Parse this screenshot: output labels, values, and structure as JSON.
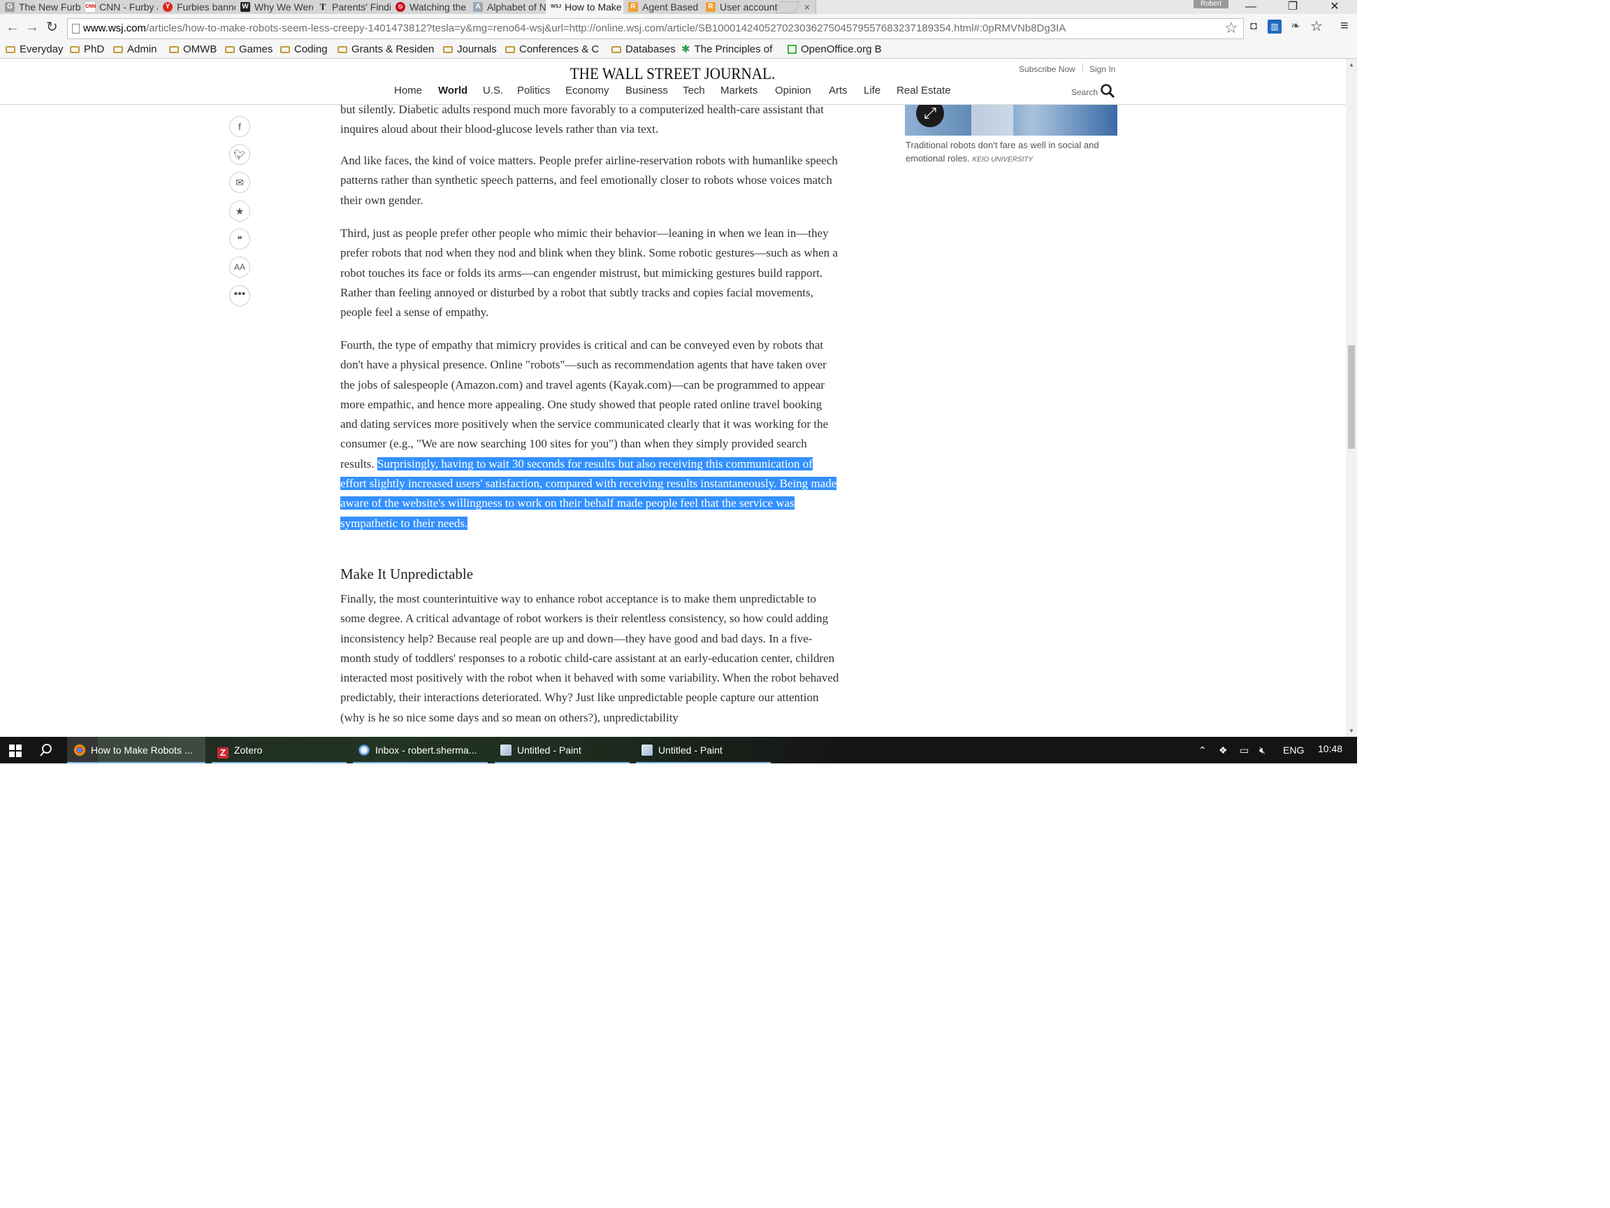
{
  "browser": {
    "tabs": [
      {
        "title": "The New Furby is",
        "favicon": "G",
        "favicon_color": "#777777",
        "active": false
      },
      {
        "title": "CNN - Furby a th",
        "favicon": "CNN",
        "favicon_color": "#cc0000",
        "active": false
      },
      {
        "title": "Furbies banned",
        "favicon": "Y",
        "favicon_color": "#e0261b",
        "active": false
      },
      {
        "title": "Why We Were A",
        "favicon": "W",
        "favicon_color": "#222222",
        "active": false
      },
      {
        "title": "Parents' Finding",
        "favicon": "T",
        "favicon_color": "#222222",
        "active": false
      },
      {
        "title": "Watching the Fu",
        "favicon": "⦸",
        "favicon_color": "#d0021b",
        "active": false
      },
      {
        "title": "Alphabet of No",
        "favicon": "A",
        "favicon_color": "#9aa7b3",
        "active": false
      },
      {
        "title": "How to Make Ro",
        "favicon": "WSJ",
        "favicon_color": "#333333",
        "active": true
      },
      {
        "title": "Agent Based M",
        "favicon": "R",
        "favicon_color": "#f0a030",
        "active": false
      },
      {
        "title": "User account | R",
        "favicon": "R",
        "favicon_color": "#f0a030",
        "active": false
      }
    ],
    "profile_name": "Robert",
    "window_controls": {
      "minimize": "—",
      "restore": "❐",
      "close": "✕"
    },
    "url_host": "www.wsj.com",
    "url_rest": "/articles/how-to-make-robots-seem-less-creepy-1401473812?tesla=y&mg=reno64-wsj&url=http://online.wsj.com/article/SB10001424052702303627504579557683237189354.html#:0pRMVNb8Dg3IA",
    "bookmarks": [
      {
        "label": "Everyday"
      },
      {
        "label": "PhD"
      },
      {
        "label": "Admin"
      },
      {
        "label": "OMWB"
      },
      {
        "label": "Games"
      },
      {
        "label": "Coding"
      },
      {
        "label": "Grants & Residen"
      },
      {
        "label": "Journals"
      },
      {
        "label": "Conferences & C"
      },
      {
        "label": "Databases"
      },
      {
        "label": "The Principles of"
      },
      {
        "label": "OpenOffice.org B"
      }
    ]
  },
  "wsj": {
    "masthead": "THE WALL STREET JOURNAL.",
    "subscribe": "Subscribe Now",
    "signin": "Sign In",
    "nav": [
      "Home",
      "World",
      "U.S.",
      "Politics",
      "Economy",
      "Business",
      "Tech",
      "Markets",
      "Opinion",
      "Arts",
      "Life",
      "Real Estate"
    ],
    "search_label": "Search"
  },
  "article": {
    "p0": "but silently. Diabetic adults respond much more favorably to a computerized health-care assistant that inquires aloud about their blood-glucose levels rather than via text.",
    "p1": "And like faces, the kind of voice matters. People prefer airline-reservation robots with humanlike speech patterns rather than synthetic speech patterns, and feel emotionally closer to robots whose voices match their own gender.",
    "p2": "Third, just as people prefer other people who mimic their behavior—leaning in when we lean in—they prefer robots that nod when they nod and blink when they blink. Some robotic gestures—such as when a robot touches its face or folds its arms—can engender mistrust, but mimicking gestures build rapport. Rather than feeling annoyed or disturbed by a robot that subtly tracks and copies facial movements, people feel a sense of empathy.",
    "p3_plain": "Fourth, the type of empathy that mimicry provides is critical and can be conveyed even by robots that don't have a physical presence. Online \"robots\"—such as recommendation agents that have taken over the jobs of salespeople (Amazon.com) and travel agents (Kayak.com)—can be programmed to appear more empathic, and hence more appealing. One study showed that people rated online travel booking and dating services more positively when the service communicated clearly that it was working for the consumer (e.g., \"We are now searching 100 sites for you\") than when they simply provided search results.",
    "p3_selected": "Surprisingly, having to wait 30 seconds for results but also receiving this communication of effort slightly increased users' satisfaction, compared with receiving results instantaneously. Being made aware of the website's willingness to work on their behalf made people feel that the service was sympathetic to their needs.",
    "subhead": "Make It Unpredictable",
    "p4": "Finally, the most counterintuitive way to enhance robot acceptance is to make them unpredictable to some degree. A critical advantage of robot workers is their relentless consistency, so how could adding inconsistency help? Because real people are up and down—they have good and bad days. In a five-month study of toddlers' responses to a robotic child-care assistant at an early-education center, children interacted most positively with the robot when it behaved with some variability. When the robot behaved predictably, their interactions deteriorated. Why? Just like unpredictable people capture our attention (why is he so nice some days and so mean on others?), unpredictability",
    "caption": "Traditional robots don't fare as well in social and emotional roles.",
    "caption_credit": "KEIO UNIVERSITY",
    "share_icons": [
      "facebook-icon",
      "twitter-icon",
      "email-icon",
      "star-icon",
      "comment-icon",
      "text-size-icon",
      "more-icon"
    ]
  },
  "taskbar": {
    "items": [
      {
        "label": "How to Make Robots ...",
        "icon_color": "#4285f4",
        "active": true
      },
      {
        "label": "Zotero",
        "icon_color": "#cc2936",
        "active": false
      },
      {
        "label": "Inbox - robert.sherma...",
        "icon_color": "#2a72c5",
        "active": false
      },
      {
        "label": "Untitled - Paint",
        "icon_color": "#c8d8e8",
        "active": false
      },
      {
        "label": "Untitled - Paint",
        "icon_color": "#c8d8e8",
        "active": false
      }
    ],
    "language": "ENG",
    "time": "10:48"
  }
}
